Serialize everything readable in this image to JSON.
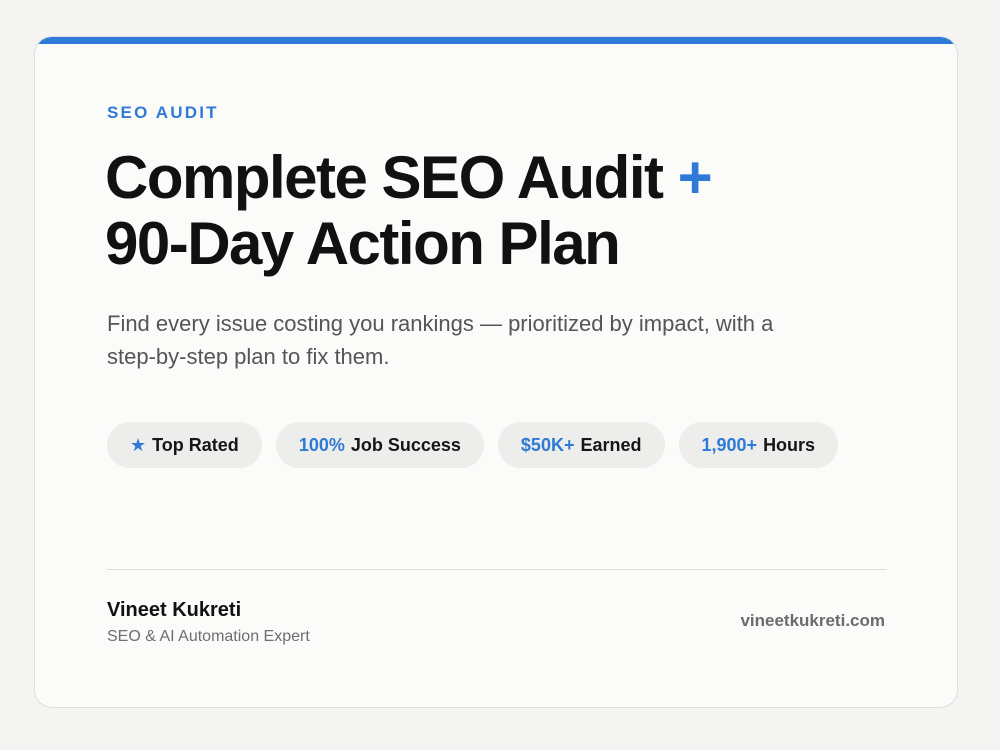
{
  "header": {
    "eyebrow": "SEO AUDIT",
    "headline_line1": "Complete SEO Audit",
    "headline_plus": "+",
    "headline_line2": "90-Day Action Plan",
    "subtitle": "Find every issue costing you rankings — prioritized by impact, with a step-by-step plan to fix them."
  },
  "stats": [
    {
      "icon": "star-icon",
      "icon_glyph": "★",
      "label": "Top Rated"
    },
    {
      "value": "100%",
      "label": "Job Success"
    },
    {
      "value": "$50K+",
      "label": "Earned"
    },
    {
      "value": "1,900+",
      "label": "Hours"
    }
  ],
  "footer": {
    "name": "Vineet Kukreti",
    "role": "SEO & AI Automation Expert",
    "website": "vineetkukreti.com"
  },
  "colors": {
    "accent": "#2f7ad6",
    "text": "#111111",
    "muted": "#555555",
    "pill_bg": "#ededeb",
    "card_bg": "#fbfbfa",
    "page_bg": "#f4f4f2"
  }
}
